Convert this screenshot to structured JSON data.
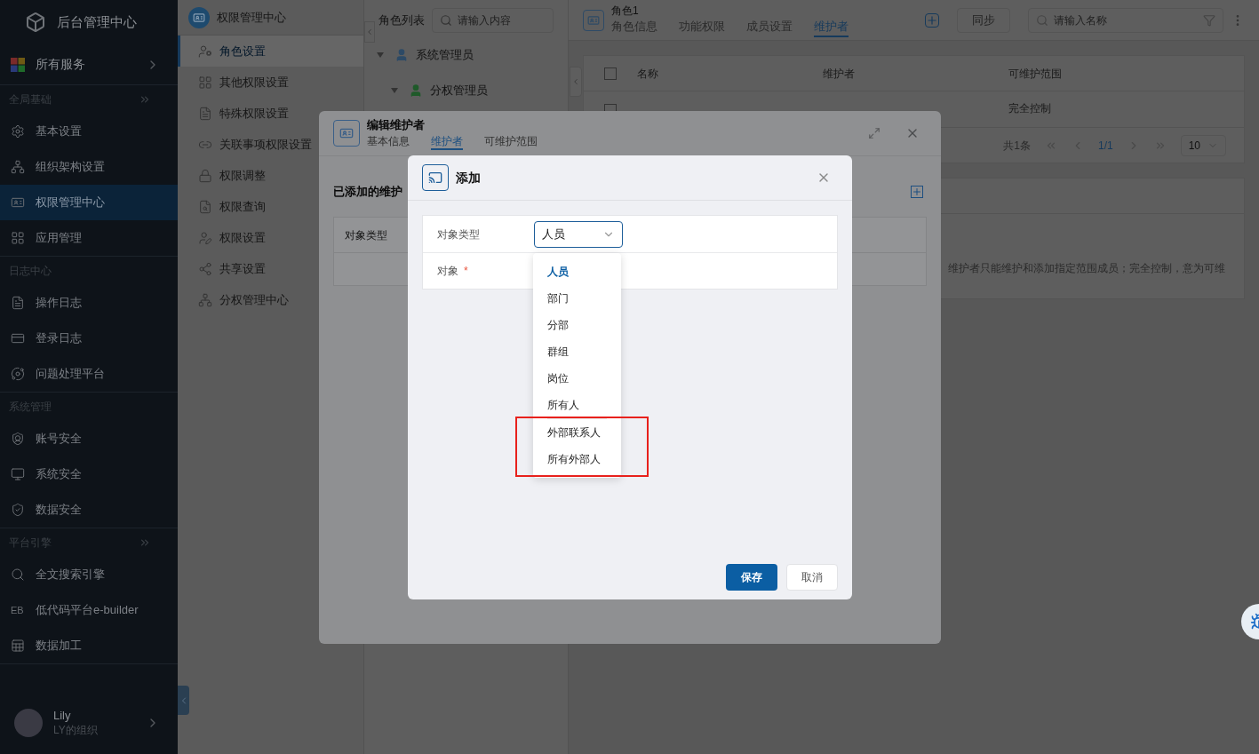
{
  "sidebar": {
    "title": "后台管理中心",
    "all_services": "所有服务",
    "groups": [
      {
        "title": "全局基础",
        "collapsible": true,
        "items": [
          {
            "label": "基本设置",
            "selected": false
          },
          {
            "label": "组织架构设置",
            "selected": false
          },
          {
            "label": "权限管理中心",
            "selected": true
          },
          {
            "label": "应用管理",
            "selected": false
          }
        ]
      },
      {
        "title": "日志中心",
        "collapsible": false,
        "items": [
          {
            "label": "操作日志",
            "selected": false
          },
          {
            "label": "登录日志",
            "selected": false
          },
          {
            "label": "问题处理平台",
            "selected": false
          }
        ]
      },
      {
        "title": "系统管理",
        "collapsible": false,
        "items": [
          {
            "label": "账号安全",
            "selected": false
          },
          {
            "label": "系统安全",
            "selected": false
          },
          {
            "label": "数据安全",
            "selected": false
          }
        ]
      },
      {
        "title": "平台引擎",
        "collapsible": true,
        "items": [
          {
            "label": "全文搜索引擎",
            "selected": false
          },
          {
            "label": "低代码平台e-builder",
            "icon_text": "EB",
            "selected": false
          },
          {
            "label": "数据加工",
            "selected": false
          }
        ]
      }
    ],
    "user": {
      "name": "Lily",
      "org": "LY的组织"
    }
  },
  "module_menu": {
    "title": "权限管理中心",
    "items": [
      {
        "label": "角色设置",
        "selected": true
      },
      {
        "label": "其他权限设置",
        "selected": false
      },
      {
        "label": "特殊权限设置",
        "selected": false
      },
      {
        "label": "关联事项权限设置",
        "selected": false
      },
      {
        "label": "权限调整",
        "selected": false
      },
      {
        "label": "权限查询",
        "selected": false
      },
      {
        "label": "权限设置",
        "selected": false
      },
      {
        "label": "共享设置",
        "selected": false
      },
      {
        "label": "分权管理中心",
        "selected": false
      }
    ]
  },
  "role_list": {
    "title": "角色列表",
    "search_placeholder": "请输入内容",
    "tree": [
      {
        "label": "系统管理员",
        "expanded": true,
        "children": [
          {
            "label": "分权管理员",
            "expanded": true
          }
        ]
      }
    ]
  },
  "role_panel": {
    "title": "角色1",
    "tabs": [
      {
        "label": "角色信息",
        "selected": false
      },
      {
        "label": "功能权限",
        "selected": false
      },
      {
        "label": "成员设置",
        "selected": false
      },
      {
        "label": "维护者",
        "selected": true
      }
    ],
    "sync_button": "同步",
    "search_placeholder": "请输入名称",
    "table": {
      "all_checked": false,
      "columns": [
        "名称",
        "维护者",
        "可维护范围"
      ],
      "rows": [
        {
          "checked": false,
          "column_3": "完全控制"
        }
      ]
    },
    "pagination": {
      "total": "共1条",
      "page": "1/1",
      "page_size": "10"
    },
    "note": "维护者只能维护和添加指定范围成员；完全控制，意为可维"
  },
  "edit_dialog": {
    "title": "编辑维护者",
    "tabs": [
      {
        "label": "基本信息",
        "selected": false
      },
      {
        "label": "维护者",
        "selected": true
      },
      {
        "label": "可维护范围",
        "selected": false
      }
    ],
    "section_title": "已添加的维护",
    "table_columns": [
      "对象类型"
    ]
  },
  "add_dialog": {
    "title": "添加",
    "fields": [
      {
        "label": "对象类型",
        "value": "人员"
      },
      {
        "label": "对象",
        "required_mark": "*"
      }
    ],
    "dropdown": {
      "groups": [
        {
          "highlighted": false,
          "options": [
            {
              "label": "人员",
              "selected": true
            },
            {
              "label": "部门",
              "selected": false
            },
            {
              "label": "分部",
              "selected": false
            },
            {
              "label": "群组",
              "selected": false
            },
            {
              "label": "岗位",
              "selected": false
            },
            {
              "label": "所有人",
              "selected": false
            }
          ]
        },
        {
          "highlighted": true,
          "options": [
            {
              "label": "外部联系人",
              "selected": false
            },
            {
              "label": "所有外部人",
              "selected": false
            }
          ]
        }
      ]
    },
    "buttons": [
      {
        "label": "保存",
        "primary": true
      },
      {
        "label": "取消",
        "primary": false
      }
    ]
  }
}
